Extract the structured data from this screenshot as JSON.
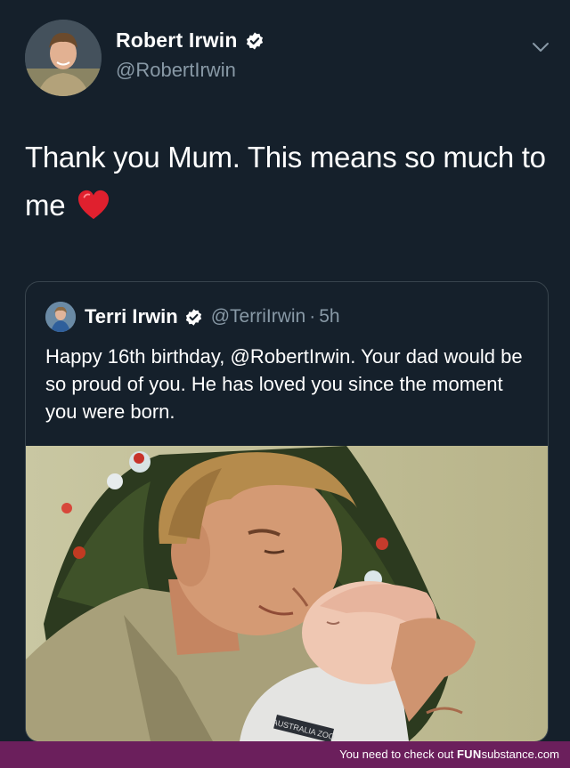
{
  "author": {
    "display_name": "Robert Irwin",
    "handle": "@RobertIrwin",
    "verified": true
  },
  "tweet": {
    "text": "Thank you Mum. This means so much to me",
    "emoji": "red-heart"
  },
  "quoted_tweet": {
    "display_name": "Terri Irwin",
    "handle": "@TerriIrwin",
    "separator": "·",
    "time": "5h",
    "verified": true,
    "text": "Happy 16th birthday, @RobertIrwin. Your dad would be so proud of you. He has loved you since the moment you were born.",
    "photo_caption_text": "AUSTRALIA ZOO"
  },
  "footer": {
    "prefix": "You need to check out",
    "brand_bold": "FUN",
    "brand_rest": "substance.com"
  },
  "colors": {
    "background": "#15202b",
    "secondary_text": "#8899a6",
    "verified_badge": "#ffffff",
    "footer_bar": "#6b1f5c"
  }
}
